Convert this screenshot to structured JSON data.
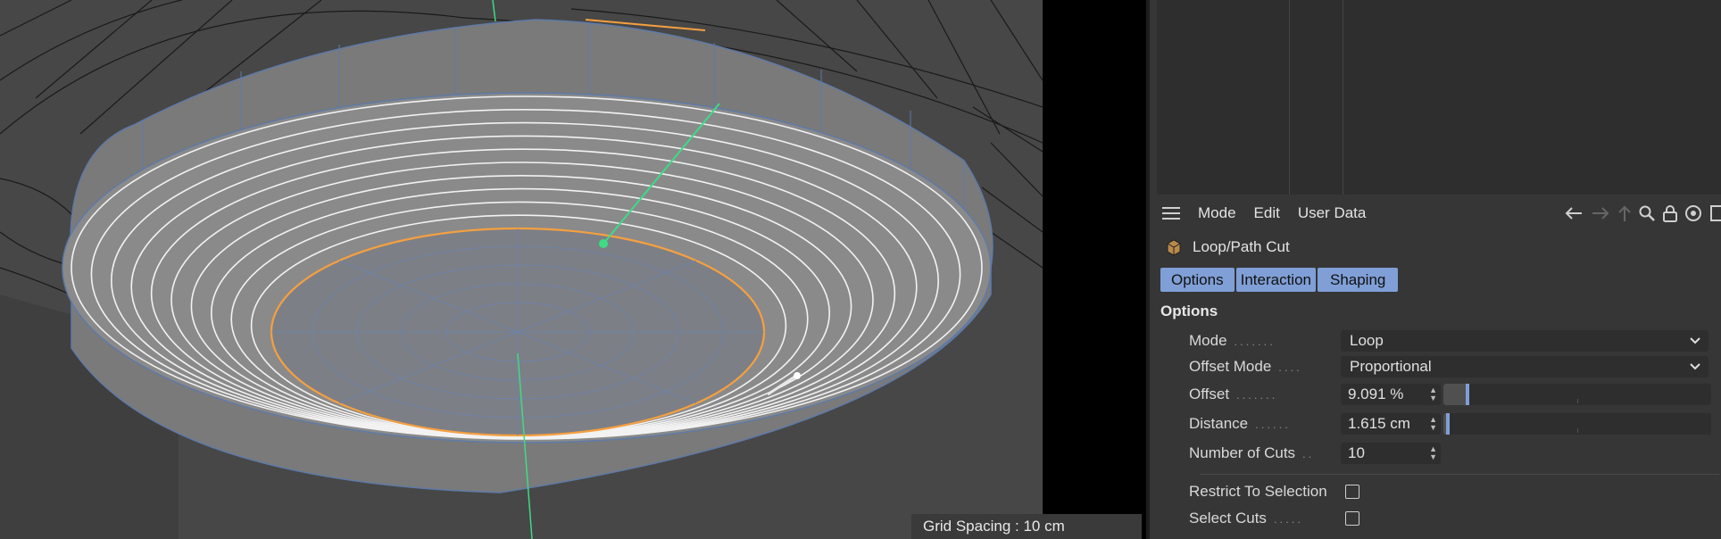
{
  "viewport": {
    "hud_text": "Grid Spacing : 10 cm"
  },
  "attributes": {
    "menu": [
      "Mode",
      "Edit",
      "User Data"
    ],
    "title": "Loop/Path Cut",
    "tabs": [
      "Options",
      "Interaction",
      "Shaping"
    ],
    "section": "Options",
    "fields": {
      "mode": {
        "label": "Mode",
        "value": "Loop"
      },
      "offset_mode": {
        "label": "Offset Mode",
        "value": "Proportional"
      },
      "offset": {
        "label": "Offset",
        "value": "9.091 %",
        "fraction": 0.09091
      },
      "distance": {
        "label": "Distance",
        "value": "1.615 cm",
        "fraction": 0.016
      },
      "cuts": {
        "label": "Number of Cuts",
        "value": "10"
      },
      "restrict": {
        "label": "Restrict To Selection",
        "checked": false
      },
      "select_cuts": {
        "label": "Select Cuts",
        "checked": false
      }
    }
  },
  "colors": {
    "accent": "#7f9fd6",
    "selection": "#f5a040",
    "axis": "#3ddc84"
  }
}
